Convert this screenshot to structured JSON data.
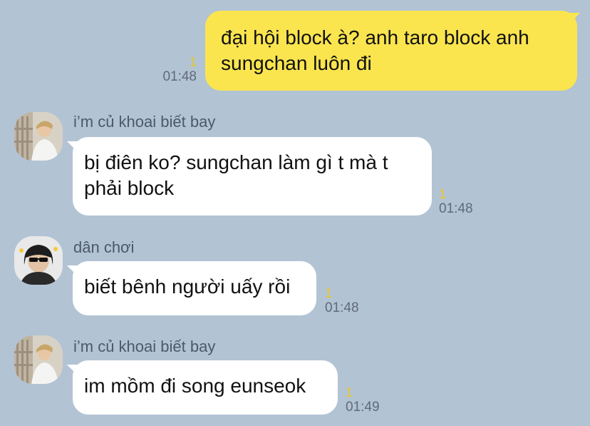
{
  "messages": [
    {
      "direction": "outgoing",
      "text": "đại hội block à? anh taro block anh sungchan luôn đi",
      "unread_count": "1",
      "time": "01:48"
    },
    {
      "direction": "incoming",
      "sender": "i’m củ khoai biết bay",
      "avatar_icon": "person-photo-avatar",
      "text": "bị điên ko? sungchan làm gì t mà t phải block",
      "unread_count": "1",
      "time": "01:48"
    },
    {
      "direction": "incoming",
      "sender": "dân chơi",
      "avatar_icon": "person-sunglasses-avatar",
      "text": "biết bênh người uấy rồi",
      "unread_count": "1",
      "time": "01:48"
    },
    {
      "direction": "incoming",
      "sender": "i’m củ khoai biết bay",
      "avatar_icon": "person-photo-avatar",
      "text": "im mồm đi song eunseok",
      "unread_count": "1",
      "time": "01:49"
    }
  ],
  "colors": {
    "background": "#b2c3d4",
    "outgoing_bubble": "#fbe54f",
    "incoming_bubble": "#ffffff",
    "unread_count": "#e8c724",
    "time": "#5f6b77"
  }
}
